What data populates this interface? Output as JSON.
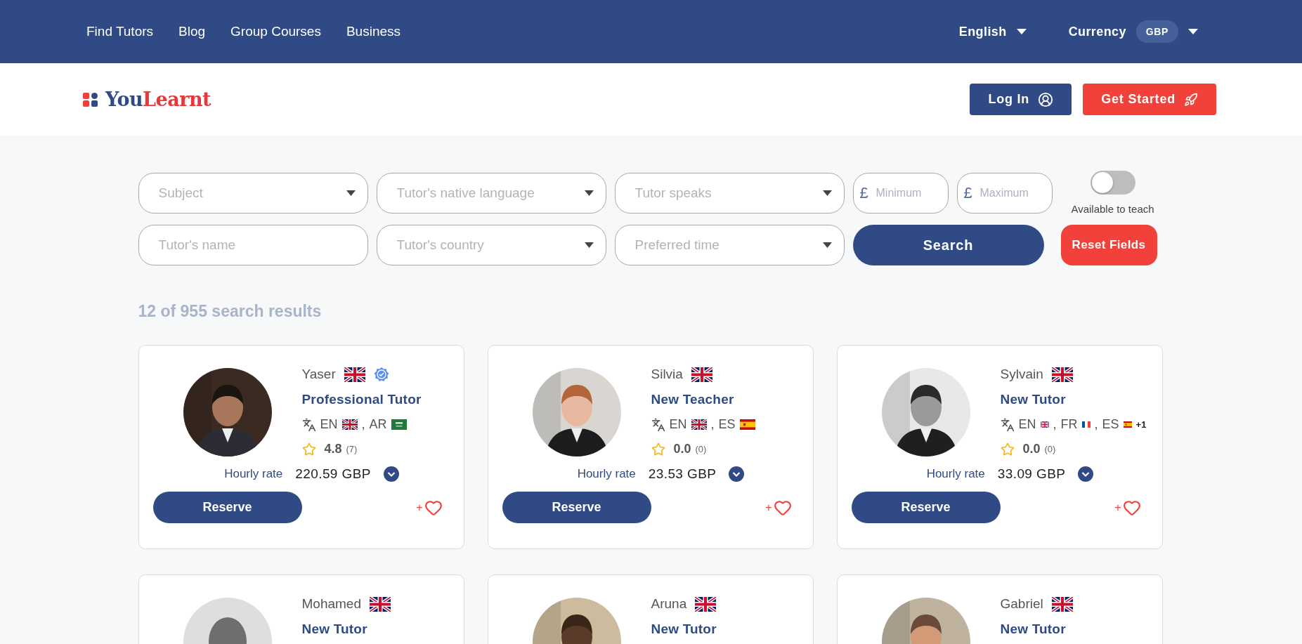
{
  "top_nav": {
    "links": [
      "Find Tutors",
      "Blog",
      "Group Courses",
      "Business"
    ],
    "language": "English",
    "currency_label": "Currency",
    "currency": "GBP"
  },
  "header": {
    "logo": {
      "part1": "You",
      "part2": "Learnt"
    },
    "login": "Log In",
    "get_started": "Get Started"
  },
  "filters": {
    "row1": [
      {
        "kind": "select",
        "placeholder": "Subject"
      },
      {
        "kind": "select",
        "placeholder": "Tutor's native language"
      },
      {
        "kind": "select",
        "placeholder": "Tutor speaks"
      },
      {
        "kind": "price",
        "symbol": "£",
        "placeholder": "Minimum"
      },
      {
        "kind": "price",
        "symbol": "£",
        "placeholder": "Maximum"
      }
    ],
    "toggle": {
      "label": "Available to teach",
      "on": false
    },
    "row2": [
      {
        "kind": "text",
        "placeholder": "Tutor's name"
      },
      {
        "kind": "select",
        "placeholder": "Tutor's country"
      },
      {
        "kind": "select",
        "placeholder": "Preferred time"
      }
    ],
    "search": "Search",
    "reset": "Reset Fields"
  },
  "results_count": "12 of 955 search results",
  "tutors": [
    {
      "photo": {
        "kind": "picture"
      },
      "name": "Yaser",
      "verified": true,
      "title": "Professional Tutor",
      "compact_flags": false,
      "language_separator": ",",
      "languages": [
        {
          "code": "EN",
          "kind": "uk"
        },
        {
          "code": "AR",
          "kind": "sa"
        }
      ],
      "rating": "4.8",
      "reviews": "(7)",
      "rate_label": "Hourly rate",
      "rate": "220.59 GBP",
      "reserve": "Reserve",
      "favorite_prefix": "+"
    },
    {
      "photo": {
        "kind": "picture"
      },
      "name": "Silvia",
      "verified": false,
      "title": "New Teacher",
      "compact_flags": false,
      "language_separator": ",",
      "languages": [
        {
          "code": "EN",
          "kind": "uk"
        },
        {
          "code": "ES",
          "kind": "es"
        }
      ],
      "rating": "0.0",
      "reviews": "(0)",
      "rate_label": "Hourly rate",
      "rate": "23.53 GBP",
      "reserve": "Reserve",
      "favorite_prefix": "+"
    },
    {
      "photo": {
        "kind": "picture"
      },
      "name": "Sylvain",
      "verified": false,
      "title": "New Tutor",
      "compact_flags": true,
      "language_separator": ",",
      "languages": [
        {
          "code": "EN",
          "kind": "uk"
        },
        {
          "code": "FR",
          "kind": "fr"
        },
        {
          "code": "ES",
          "kind": "es"
        }
      ],
      "more_languages": "+1",
      "rating": "0.0",
      "reviews": "(0)",
      "rate_label": "Hourly rate",
      "rate": "33.09 GBP",
      "reserve": "Reserve",
      "favorite_prefix": "+"
    },
    {
      "photo": {
        "kind": "default-avatar"
      },
      "name": "Mohamed",
      "verified": false,
      "title": "New Tutor"
    },
    {
      "photo": {
        "kind": "picture"
      },
      "name": "Aruna",
      "verified": false,
      "title": "New Tutor"
    },
    {
      "photo": {
        "kind": "picture"
      },
      "name": "Gabriel",
      "verified": false,
      "title": "New Tutor"
    }
  ]
}
